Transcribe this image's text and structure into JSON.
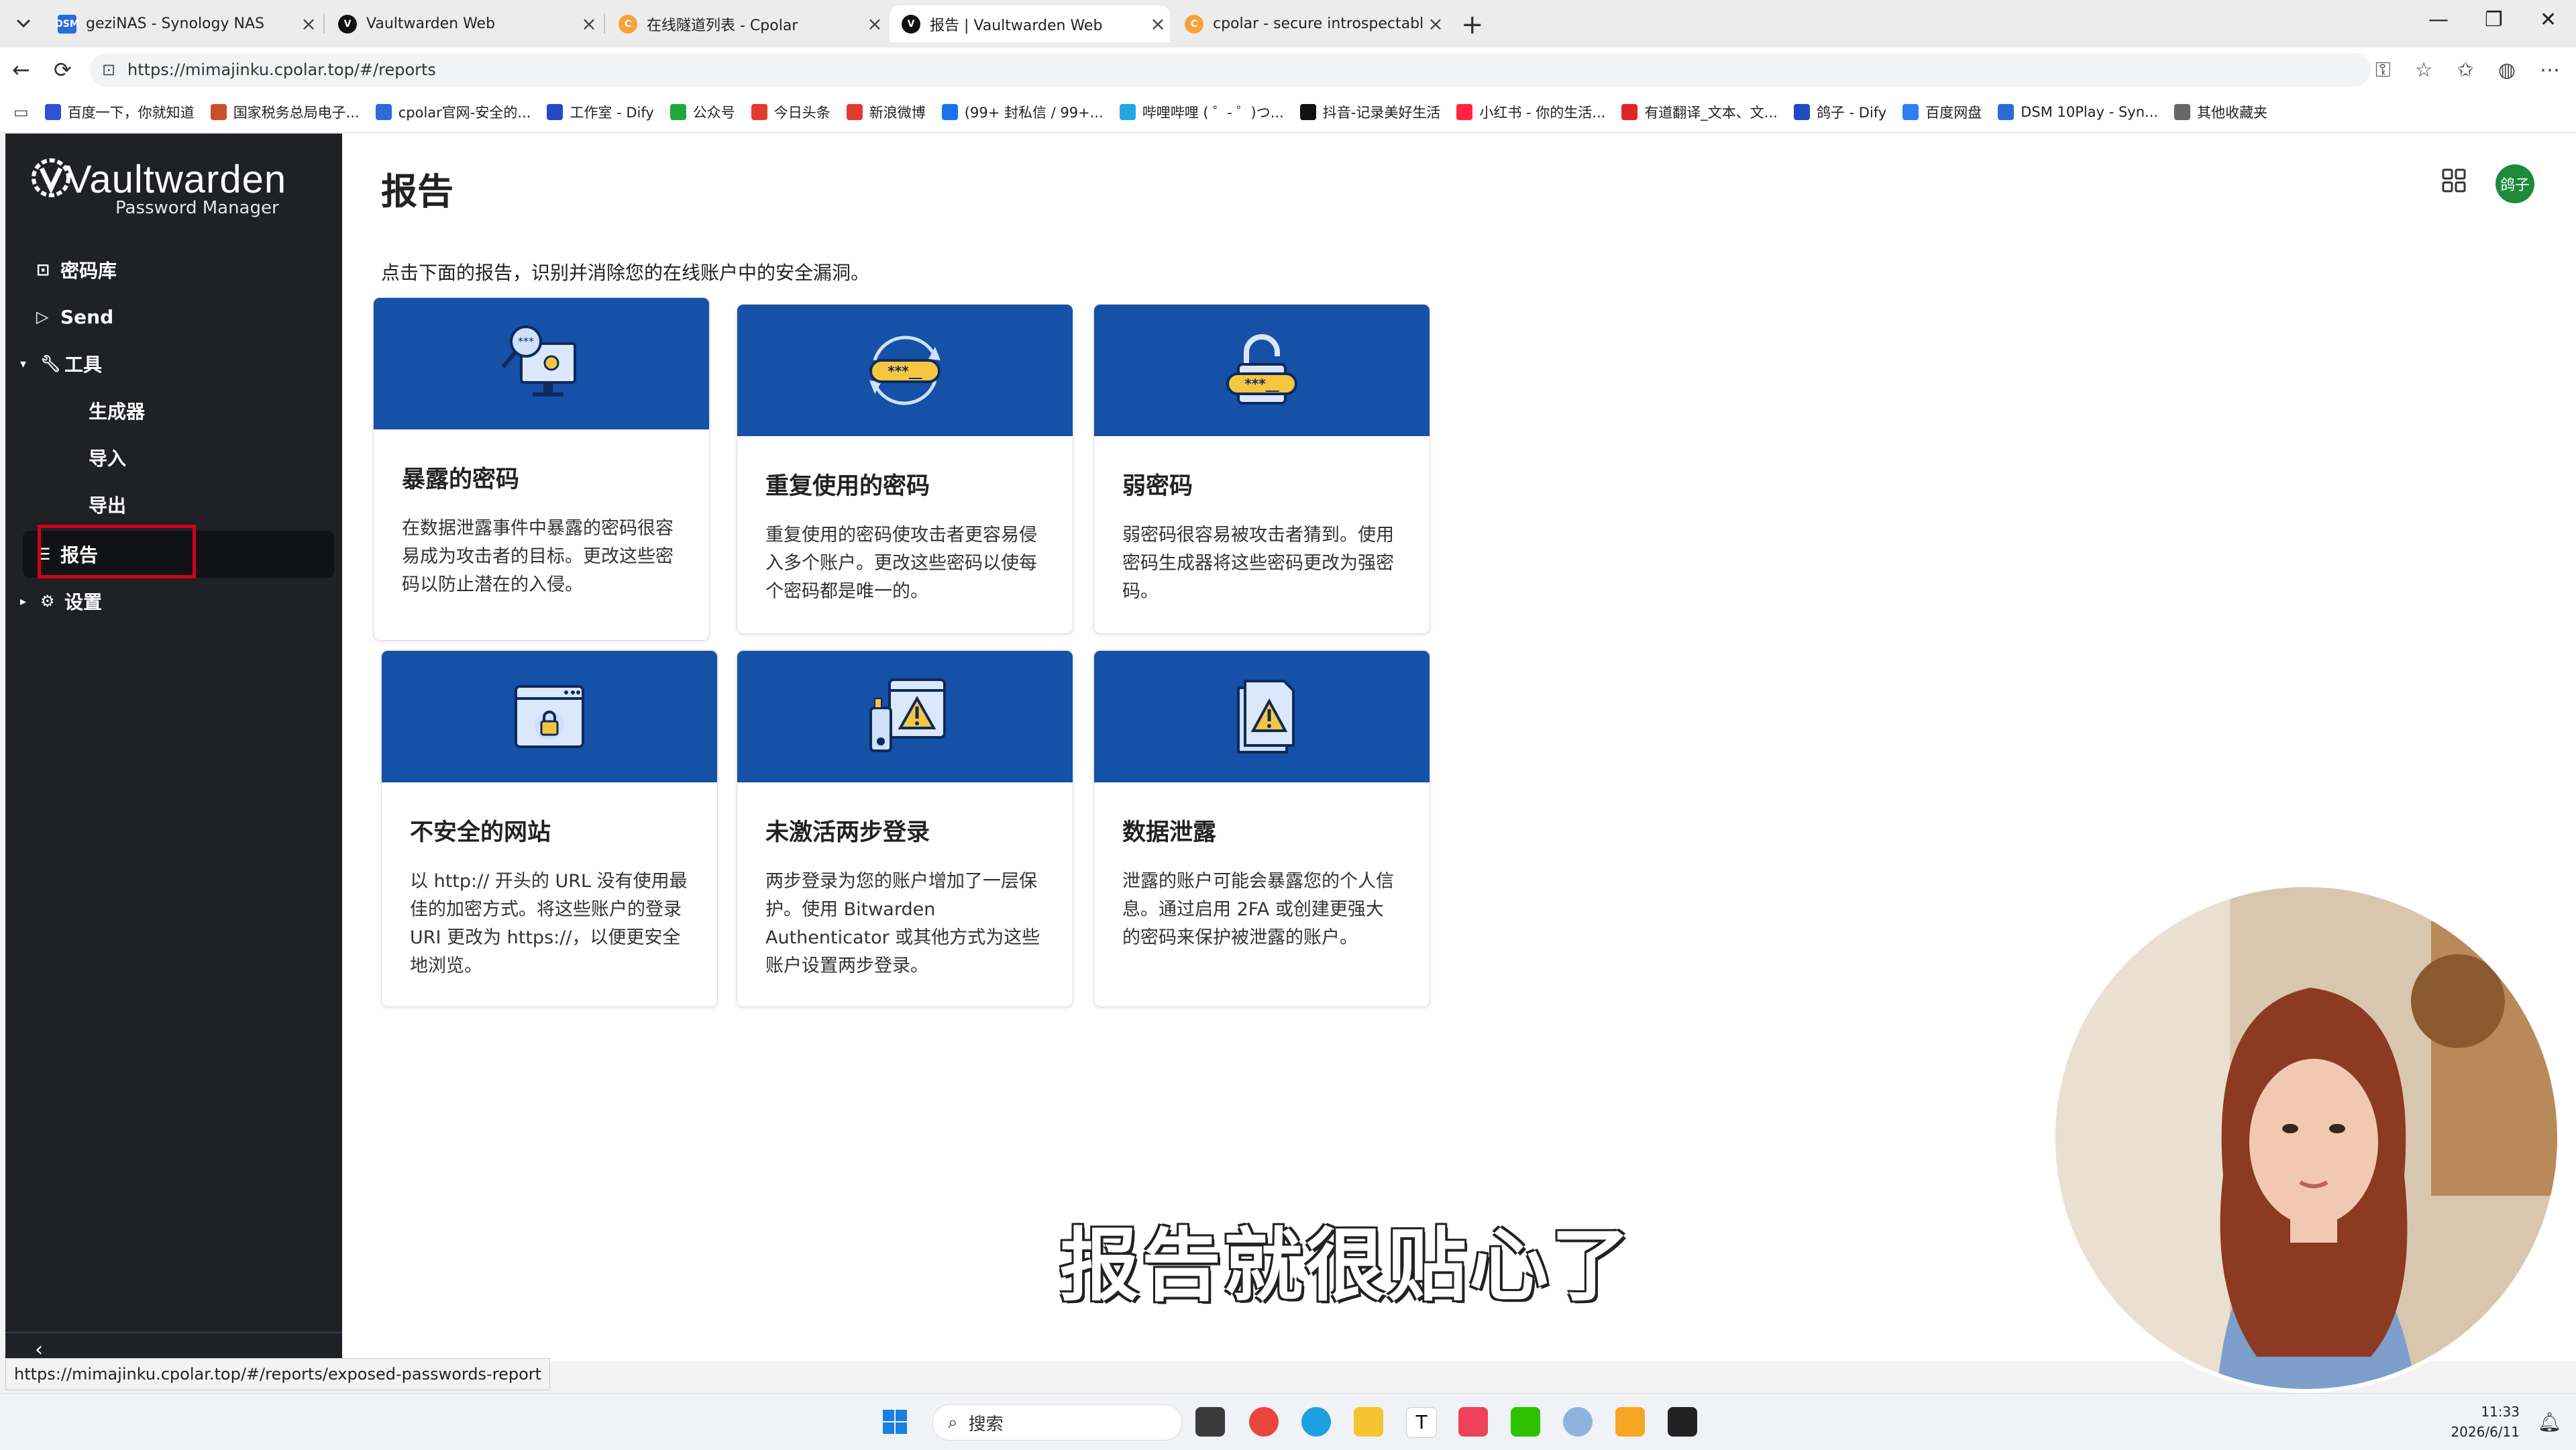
{
  "browser": {
    "tabs": [
      {
        "title": "geziNAS - Synology NAS",
        "icon": "dsm-icon",
        "active": false
      },
      {
        "title": "Vaultwarden Web",
        "icon": "vaultwarden-icon",
        "active": false
      },
      {
        "title": "在线隧道列表 - Cpolar",
        "icon": "cpolar-icon",
        "active": false
      },
      {
        "title": "报告 | Vaultwarden Web",
        "icon": "vaultwarden-icon",
        "active": true
      },
      {
        "title": "cpolar - secure introspectable tunn",
        "icon": "cpolar-icon",
        "active": false
      }
    ],
    "url": "https://mimajinku.cpolar.top/#/reports",
    "bookmarks": [
      {
        "label": "百度一下，你就知道",
        "color": "#3052d6"
      },
      {
        "label": "国家税务总局电子...",
        "color": "#c8512a"
      },
      {
        "label": "cpolar官网-安全的...",
        "color": "#2c6cd6"
      },
      {
        "label": "工作室 - Dify",
        "color": "#2548c7"
      },
      {
        "label": "公众号",
        "color": "#1fa83b"
      },
      {
        "label": "今日头条",
        "color": "#e33b2e"
      },
      {
        "label": "新浪微博",
        "color": "#e03c31"
      },
      {
        "label": "(99+ 封私信 / 99+...",
        "color": "#1772f6"
      },
      {
        "label": "哔哩哔哩 ( ゜- ゜)つ...",
        "color": "#23a7e3"
      },
      {
        "label": "抖音-记录美好生活",
        "color": "#111111"
      },
      {
        "label": "小红书 - 你的生活...",
        "color": "#ff2442"
      },
      {
        "label": "有道翻译_文本、文...",
        "color": "#e0242a"
      },
      {
        "label": "鸽子 - Dify",
        "color": "#2548c7"
      },
      {
        "label": "百度网盘",
        "color": "#2f7ef6"
      },
      {
        "label": "DSM 10Play - Syn...",
        "color": "#2a6cd8"
      },
      {
        "label": "其他收藏夹",
        "color": "#666666"
      }
    ]
  },
  "app": {
    "logo_main": "Vaultwarden",
    "logo_sub": "Password Manager",
    "nav": [
      {
        "label": "密码库",
        "icon": "vault-icon"
      },
      {
        "label": "Send",
        "icon": "send-icon"
      },
      {
        "label": "工具",
        "icon": "wrench-icon",
        "expanded": true
      },
      {
        "label": "生成器",
        "sub": true
      },
      {
        "label": "导入",
        "sub": true
      },
      {
        "label": "导出",
        "sub": true
      },
      {
        "label": "报告",
        "icon": "sliders-icon",
        "active": true
      },
      {
        "label": "设置",
        "icon": "gear-icon",
        "expanded": false
      }
    ],
    "page_title": "报告",
    "avatar": "鸽子",
    "intro": "点击下面的报告，识别并消除您的在线账户中的安全漏洞。",
    "cards": [
      {
        "title": "暴露的密码",
        "desc": "在数据泄露事件中暴露的密码很容易成为攻击者的目标。更改这些密码以防止潜在的入侵。"
      },
      {
        "title": "重复使用的密码",
        "desc": "重复使用的密码使攻击者更容易侵入多个账户。更改这些密码以使每个密码都是唯一的。"
      },
      {
        "title": "弱密码",
        "desc": "弱密码很容易被攻击者猜到。使用密码生成器将这些密码更改为强密码。"
      },
      {
        "title": "不安全的网站",
        "desc": "以 http:// 开头的 URL 没有使用最佳的加密方式。将这些账户的登录 URI 更改为 https://，以便更安全地浏览。"
      },
      {
        "title": "未激活两步登录",
        "desc": "两步登录为您的账户增加了一层保护。使用 Bitwarden Authenticator 或其他方式为这些账户设置两步登录。"
      },
      {
        "title": "数据泄露",
        "desc": "泄露的账户可能会暴露您的个人信息。通过启用 2FA 或创建更强大的密码来保护被泄露的账户。"
      }
    ]
  },
  "overlay": {
    "subtitle": "报告就很贴心了",
    "status_url": "https://mimajinku.cpolar.top/#/reports/exposed-passwords-report"
  },
  "taskbar": {
    "search_placeholder": "搜索",
    "time": "11:33",
    "date": "2026/6/11"
  },
  "colors": {
    "sidebar": "#1f2124",
    "banner": "#1551a6",
    "highlight": "#d0021b",
    "avatar": "#1d8a3a"
  }
}
